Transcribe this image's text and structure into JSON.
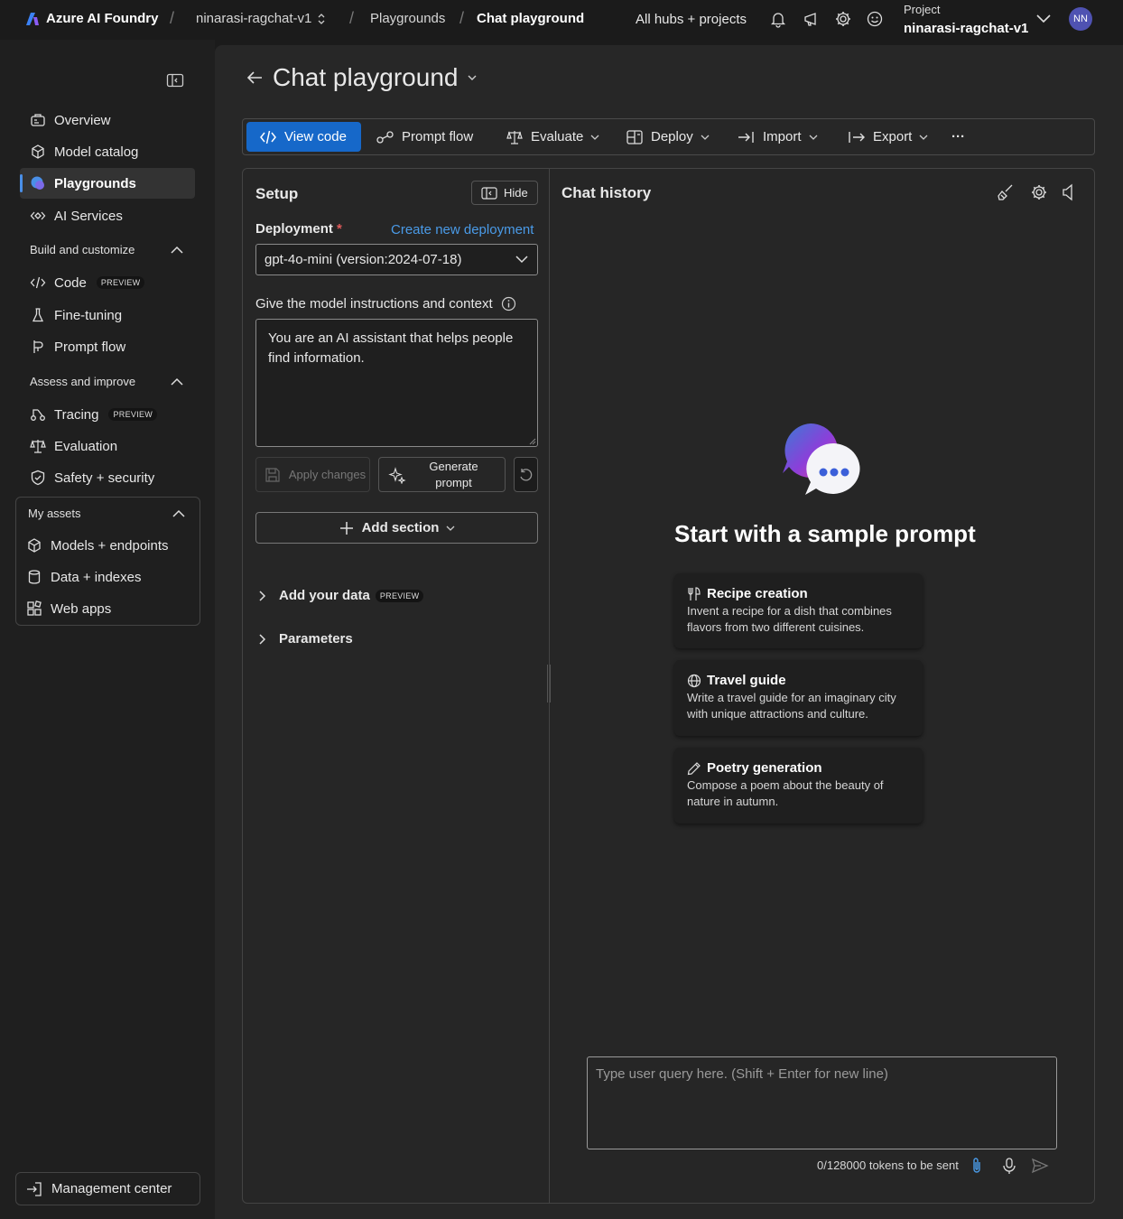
{
  "topbar": {
    "brand": "Azure AI Foundry",
    "project_switch": "ninarasi-ragchat-v1",
    "crumb_playgrounds": "Playgrounds",
    "crumb_current": "Chat playground",
    "all_hubs": "All hubs + projects",
    "project_label": "Project",
    "project_name": "ninarasi-ragchat-v1",
    "avatar_initials": "NN"
  },
  "sidebar": {
    "items": [
      {
        "label": "Overview"
      },
      {
        "label": "Model catalog"
      },
      {
        "label": "Playgrounds"
      },
      {
        "label": "AI Services"
      }
    ],
    "group_build": "Build and customize",
    "build_items": [
      {
        "label": "Code",
        "badge": "PREVIEW"
      },
      {
        "label": "Fine-tuning"
      },
      {
        "label": "Prompt flow"
      }
    ],
    "group_assess": "Assess and improve",
    "assess_items": [
      {
        "label": "Tracing",
        "badge": "PREVIEW"
      },
      {
        "label": "Evaluation"
      },
      {
        "label": "Safety + security"
      }
    ],
    "group_assets": "My assets",
    "asset_items": [
      {
        "label": "Models + endpoints"
      },
      {
        "label": "Data + indexes"
      },
      {
        "label": "Web apps"
      }
    ],
    "management": "Management center"
  },
  "page": {
    "title": "Chat playground"
  },
  "toolbar": {
    "view_code": "View code",
    "prompt_flow": "Prompt flow",
    "evaluate": "Evaluate",
    "deploy": "Deploy",
    "import": "Import",
    "export": "Export",
    "more": "···"
  },
  "setup": {
    "title": "Setup",
    "hide": "Hide",
    "deployment_label": "Deployment",
    "required_mark": "*",
    "create_link": "Create new deployment",
    "deployment_value": "gpt-4o-mini (version:2024-07-18)",
    "instructions_label": "Give the model instructions and context",
    "instructions_value": "You are an AI assistant that helps people find information.",
    "apply_changes": "Apply changes",
    "generate_prompt": "Generate prompt",
    "add_section": "Add section",
    "add_data": "Add your data",
    "add_data_badge": "PREVIEW",
    "parameters": "Parameters"
  },
  "chat": {
    "title": "Chat history",
    "empty_heading": "Start with a sample prompt",
    "samples": [
      {
        "title": "Recipe creation",
        "desc": "Invent a recipe for a dish that combines flavors from two different cuisines."
      },
      {
        "title": "Travel guide",
        "desc": "Write a travel guide for an imaginary city with unique attractions and culture."
      },
      {
        "title": "Poetry generation",
        "desc": "Compose a poem about the beauty of nature in autumn."
      }
    ],
    "input_placeholder": "Type user query here. (Shift + Enter for new line)",
    "token_count": "0/128000 tokens to be sent"
  },
  "colors": {
    "accent": "#1668c9",
    "link": "#4a9be8",
    "required": "#e05a5a",
    "avatar": "#4f52b2"
  }
}
